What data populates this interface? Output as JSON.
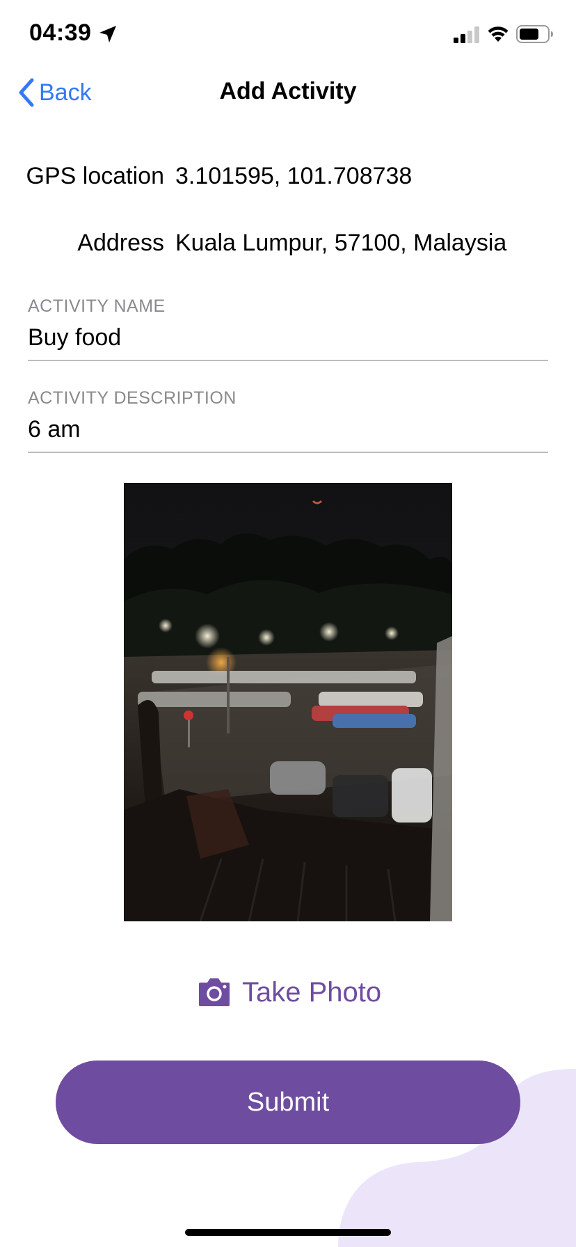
{
  "status_bar": {
    "time": "04:39",
    "icons": [
      "location-arrow-icon",
      "cellular-signal-icon",
      "wifi-icon",
      "battery-icon"
    ]
  },
  "nav": {
    "back_label": "Back",
    "title": "Add Activity",
    "back_color": "#3478f6"
  },
  "info": {
    "gps_label": "GPS location",
    "gps_value": "3.101595, 101.708738",
    "address_label": "Address",
    "address_value": "Kuala Lumpur, 57100, Malaysia"
  },
  "fields": {
    "name_label": "ACTIVITY NAME",
    "name_value": "Buy food",
    "description_label": "ACTIVITY DESCRIPTION",
    "description_value": "6 am"
  },
  "photo": {
    "subject": "night-parking-lot-photo"
  },
  "actions": {
    "take_photo_label": "Take Photo",
    "submit_label": "Submit"
  },
  "colors": {
    "accent": "#6e4c9f",
    "blob": "#ece5fa",
    "link": "#3478f6"
  }
}
